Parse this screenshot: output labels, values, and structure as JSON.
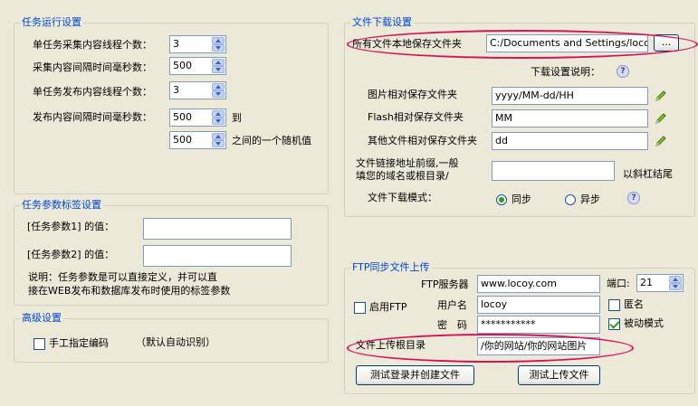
{
  "task_run": {
    "title": "任务运行设置",
    "collect_threads_label": "单任务采集内容线程个数：",
    "collect_threads_value": "3",
    "collect_interval_label": "采集内容间隔时间毫秒数：",
    "collect_interval_value": "500",
    "publish_threads_label": "单任务发布内容线程个数：",
    "publish_threads_value": "3",
    "publish_interval_label": "发布内容间隔时间毫秒数：",
    "publish_interval_min": "500",
    "to_label": "到",
    "publish_interval_max": "500",
    "random_label": "之间的一个随机值"
  },
  "task_params": {
    "title": "任务参数标签设置",
    "param1_label": "[任务参数1] 的值：",
    "param1_value": "",
    "param2_label": "[任务参数2] 的值：",
    "param2_value": "",
    "note_line1": "说明：任务参数是可以直接定义，并可以直",
    "note_line2": "接在WEB发布和数据库发布时使用的标签参数"
  },
  "advanced": {
    "title": "高级设置",
    "manual_encoding_label": "手工指定编码",
    "manual_encoding_checked": false,
    "default_auto_label": "（默认自动识别）"
  },
  "download": {
    "title": "文件下载设置",
    "save_dir_label": "所有文件本地保存文件夹",
    "save_dir_value": "C:/Documents and Settings/locoy/桌",
    "browse_label": "...",
    "help_title": "下载设置说明：",
    "image_dir_label": "图片相对保存文件夹",
    "image_dir_value": "yyyy/MM-dd/HH",
    "flash_dir_label": "Flash相对保存文件夹",
    "flash_dir_value": "MM",
    "other_dir_label": "其他文件相对保存文件夹",
    "other_dir_value": "dd",
    "prefix_label_line1": "文件链接地址前缀,一般",
    "prefix_label_line2": "填您的域名或根目录/",
    "prefix_value": "",
    "slash_suffix": "以斜杠结尾",
    "mode_label": "文件下载模式：",
    "mode_sync": "同步",
    "mode_async": "异步",
    "mode_selected": "sync"
  },
  "ftp": {
    "title": "FTP同步文件上传",
    "enable_label": "启用FTP",
    "enable_checked": false,
    "server_label": "FTP服务器",
    "server_value": "www.locoy.com",
    "port_label": "端口:",
    "port_value": "21",
    "user_label": "用户名",
    "user_value": "locoy",
    "anonymous_label": "匿名",
    "anonymous_checked": false,
    "password_label": "密　码",
    "password_value": "***********",
    "passive_label": "被动模式",
    "passive_checked": true,
    "root_dir_label": "文件上传根目录",
    "root_dir_value": "/你的网站/你的网站图片",
    "test_login_button": "测试登录并创建文件",
    "test_upload_button": "测试上传文件"
  },
  "colors": {
    "background": "#ece9d8",
    "group_title": "#0046d5",
    "highlight_oval": "#d4145a"
  }
}
